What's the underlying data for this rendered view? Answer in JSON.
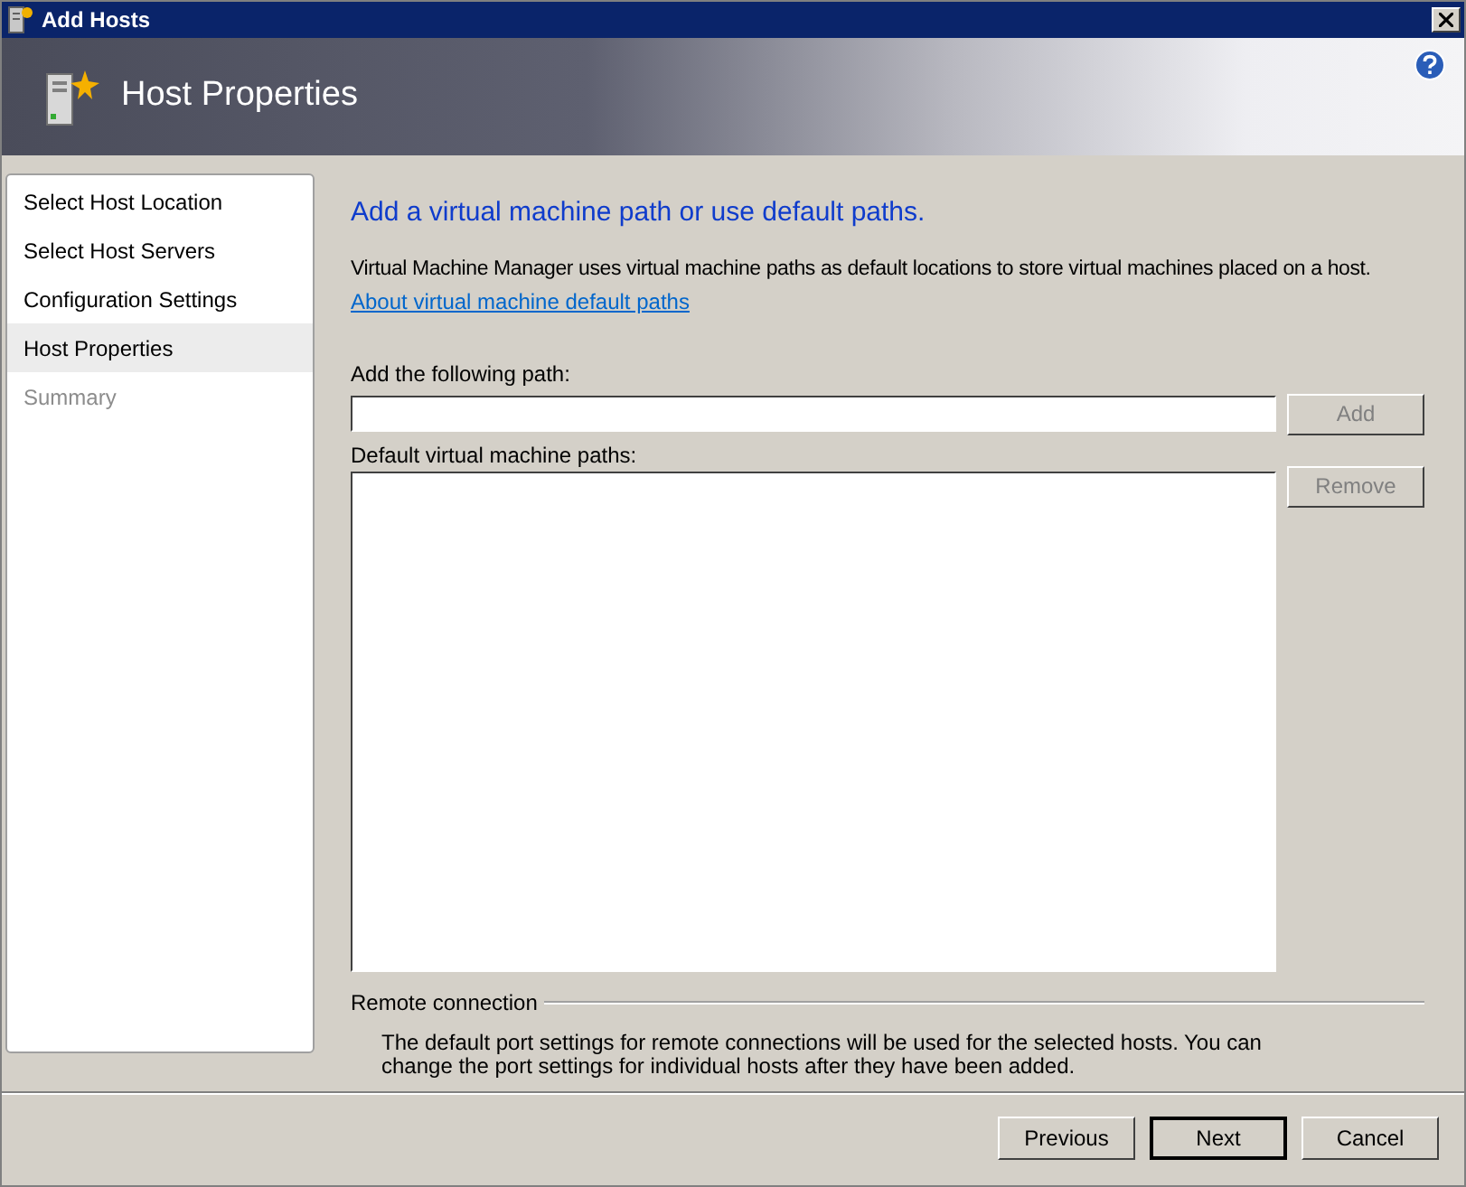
{
  "window": {
    "title": "Add Hosts"
  },
  "header": {
    "title": "Host Properties"
  },
  "steps": [
    {
      "label": "Select Host Location",
      "selected": false,
      "disabled": false
    },
    {
      "label": "Select Host Servers",
      "selected": false,
      "disabled": false
    },
    {
      "label": "Configuration Settings",
      "selected": false,
      "disabled": false
    },
    {
      "label": "Host Properties",
      "selected": true,
      "disabled": false
    },
    {
      "label": "Summary",
      "selected": false,
      "disabled": true
    }
  ],
  "page": {
    "heading": "Add a virtual machine path or use default paths.",
    "description": "Virtual Machine Manager uses virtual machine paths as default locations to store virtual machines placed on a host.",
    "link": "About virtual machine default paths",
    "path_label": "Add the following path:",
    "add_button": {
      "label": "Add",
      "disabled": true
    },
    "list_label": "Default virtual machine paths:",
    "remove_button": {
      "label": "Remove",
      "disabled": true
    },
    "remote_section": "Remote connection",
    "remote_text": "The default port settings for remote connections will be used for the selected hosts. You can change the port settings for individual hosts after they have been added."
  },
  "buttons": [
    {
      "label": "Previous",
      "default": false
    },
    {
      "label": "Next",
      "default": true
    },
    {
      "label": "Cancel",
      "default": false
    }
  ]
}
